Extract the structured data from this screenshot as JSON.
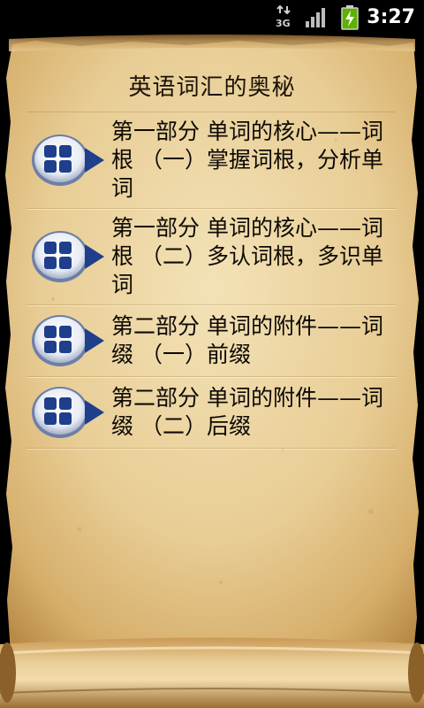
{
  "status_bar": {
    "network_label": "3G",
    "time": "3:27"
  },
  "icons": {
    "network": "network-3g-icon",
    "signal": "signal-strength-icon",
    "battery": "battery-charging-icon",
    "list_item": "grid-arrow-icon"
  },
  "colors": {
    "parchment": "#e9d2a1",
    "text": "#0d0a05",
    "icon_blue": "#1f3f8c",
    "status_bg": "#000000"
  },
  "page": {
    "title": "英语词汇的奥秘"
  },
  "items": [
    {
      "label": "第一部分 单词的核心——词根 （一）掌握词根，分析单词"
    },
    {
      "label": "第一部分 单词的核心——词根 （二）多认词根，多识单词"
    },
    {
      "label": "第二部分 单词的附件——词缀 （一）前缀"
    },
    {
      "label": "第二部分 单词的附件——词缀 （二）后缀"
    }
  ]
}
